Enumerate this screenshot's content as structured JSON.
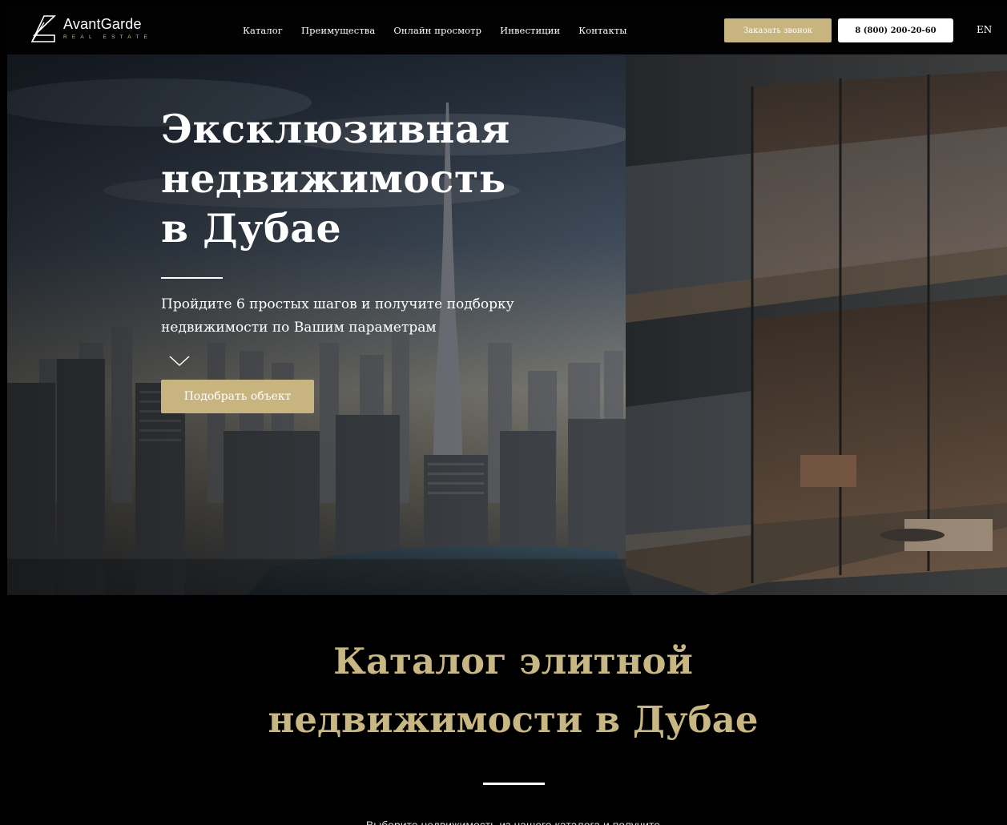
{
  "header": {
    "logo_name": "AvantGarde",
    "logo_sub": "REAL ESTATE",
    "nav": [
      "Каталог",
      "Преимущества",
      "Онлайн просмотр",
      "Инвестиции",
      "Контакты"
    ],
    "call_button": "Заказать звонок",
    "phone_button": "8 (800) 200-20-60",
    "lang": "EN"
  },
  "hero": {
    "title_line1": "Эксклюзивная",
    "title_line2": "недвижимость",
    "title_line3": "в Дубае",
    "subtitle": "Пройдите 6 простых шагов и получите подборку недвижимости по Вашим параметрам",
    "cta": "Подобрать объект"
  },
  "catalog": {
    "title_line1": "Каталог элитной",
    "title_line2": "недвижимости в Дубае",
    "description": "Выберите недвижимость из нашего каталога и получите"
  },
  "colors": {
    "gold": "#c8b47e",
    "background": "#000000"
  }
}
